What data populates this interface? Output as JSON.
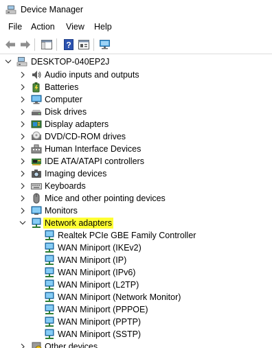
{
  "window": {
    "title": "Device Manager"
  },
  "menu": [
    "File",
    "Action",
    "View",
    "Help"
  ],
  "tree": {
    "root": "DESKTOP-040EP2J",
    "categories": [
      {
        "label": "Audio inputs and outputs",
        "icon": "speaker-icon"
      },
      {
        "label": "Batteries",
        "icon": "battery-icon"
      },
      {
        "label": "Computer",
        "icon": "computer-icon"
      },
      {
        "label": "Disk drives",
        "icon": "disk-drive-icon"
      },
      {
        "label": "Display adapters",
        "icon": "display-adapter-icon"
      },
      {
        "label": "DVD/CD-ROM drives",
        "icon": "dvd-drive-icon"
      },
      {
        "label": "Human Interface Devices",
        "icon": "hid-icon"
      },
      {
        "label": "IDE ATA/ATAPI controllers",
        "icon": "ide-controller-icon"
      },
      {
        "label": "Imaging devices",
        "icon": "camera-icon"
      },
      {
        "label": "Keyboards",
        "icon": "keyboard-icon"
      },
      {
        "label": "Mice and other pointing devices",
        "icon": "mouse-icon"
      },
      {
        "label": "Monitors",
        "icon": "monitor-icon"
      }
    ],
    "expanded": {
      "label": "Network adapters",
      "highlight_color": "#ffff33"
    },
    "network_devices": [
      "Realtek PCIe GBE Family Controller",
      "WAN Miniport (IKEv2)",
      "WAN Miniport (IP)",
      "WAN Miniport (IPv6)",
      "WAN Miniport (L2TP)",
      "WAN Miniport (Network Monitor)",
      "WAN Miniport (PPPOE)",
      "WAN Miniport (PPTP)",
      "WAN Miniport (SSTP)"
    ],
    "after": [
      {
        "label": "Other devices",
        "icon": "other-devices-icon"
      }
    ]
  }
}
